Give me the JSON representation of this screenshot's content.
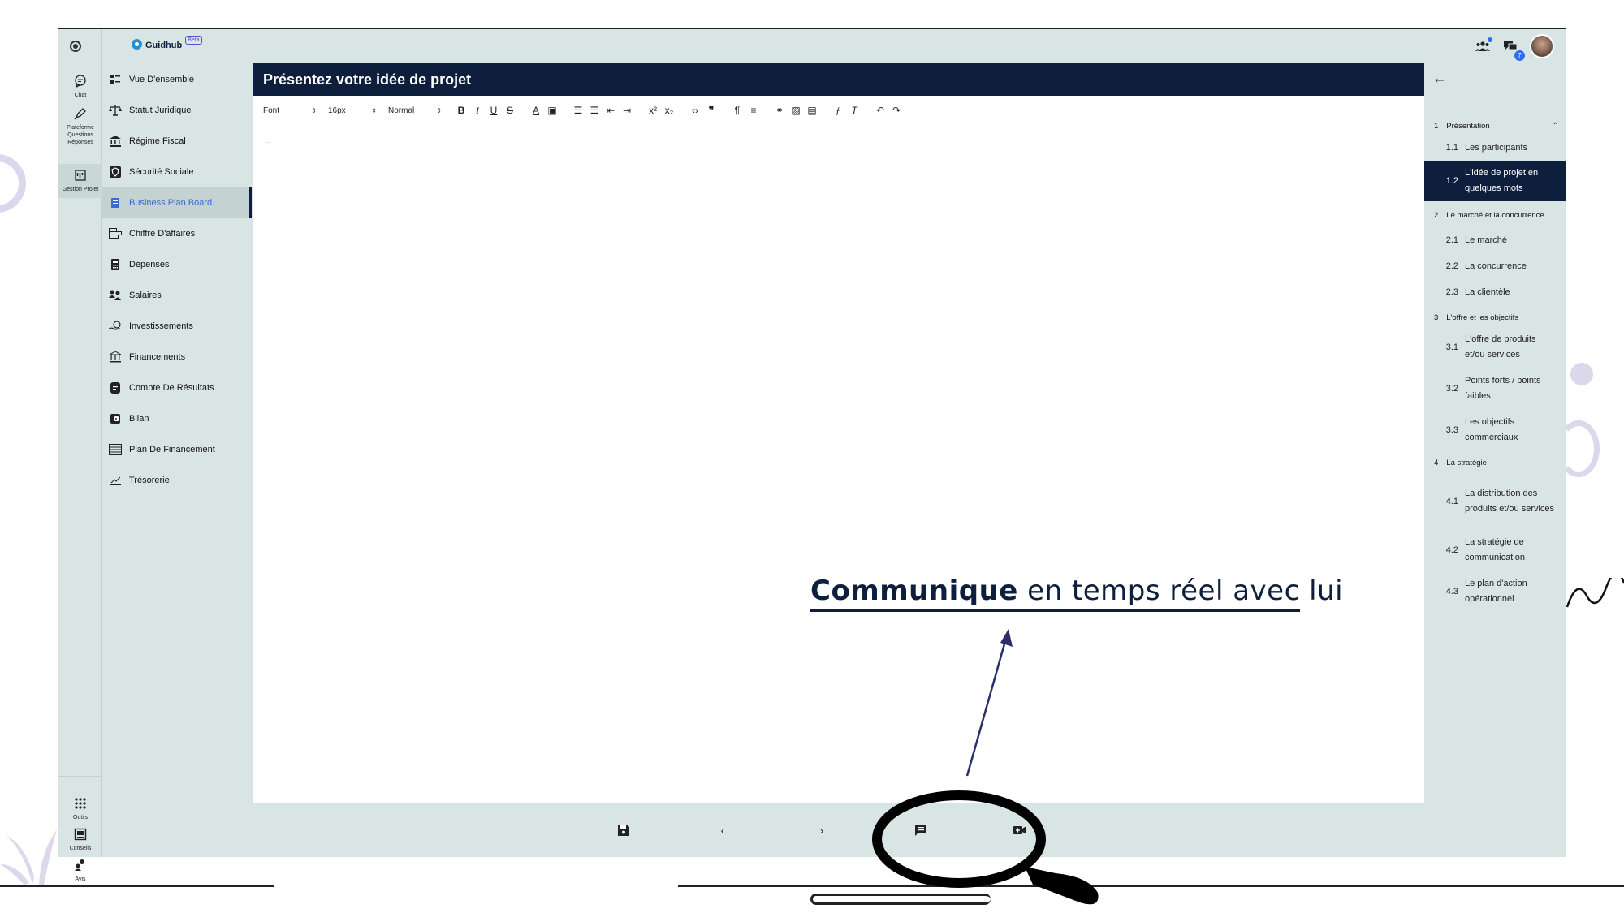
{
  "app": {
    "logo_text": "Guidhub",
    "beta_label": "Beta",
    "message_count": "7"
  },
  "rail": {
    "items": [
      {
        "label": "Chat"
      },
      {
        "label": "Plateforme Questions Réponses"
      },
      {
        "label": "Gestion Projet"
      }
    ],
    "bottom_items": [
      {
        "label": "Outils"
      },
      {
        "label": "Conseils"
      },
      {
        "label": "Avis"
      }
    ]
  },
  "sidebar": {
    "items": [
      {
        "label": "Vue D'ensemble",
        "icon": "dashboard-icon"
      },
      {
        "label": "Statut Juridique",
        "icon": "scale-icon"
      },
      {
        "label": "Régime Fiscal",
        "icon": "bank-icon"
      },
      {
        "label": "Sécurité Sociale",
        "icon": "shield-icon"
      },
      {
        "label": "Business Plan Board",
        "icon": "document-icon",
        "active": true
      },
      {
        "label": "Chiffre D'affaires",
        "icon": "bar-chart-icon"
      },
      {
        "label": "Dépenses",
        "icon": "calculator-icon"
      },
      {
        "label": "Salaires",
        "icon": "people-icon"
      },
      {
        "label": "Investissements",
        "icon": "money-hand-icon"
      },
      {
        "label": "Financements",
        "icon": "bank-icon"
      },
      {
        "label": "Compte De Résultats",
        "icon": "receipt-icon"
      },
      {
        "label": "Bilan",
        "icon": "wallet-icon"
      },
      {
        "label": "Plan De Financement",
        "icon": "table-icon"
      },
      {
        "label": "Trésorerie",
        "icon": "line-chart-icon"
      }
    ]
  },
  "editor": {
    "title": "Présentez votre idée de projet",
    "toolbar": {
      "font_label": "Font",
      "size_label": "16px",
      "style_label": "Normal"
    },
    "placeholder": "..."
  },
  "outline": {
    "sections": [
      {
        "num": "1",
        "label": "Présentation",
        "subs": [
          {
            "num": "1.1",
            "label": "Les participants"
          },
          {
            "num": "1.2",
            "label": "L'idée de projet en quelques mots",
            "active": true
          }
        ]
      },
      {
        "num": "2",
        "label": "Le marché et la concurrence",
        "subs": [
          {
            "num": "2.1",
            "label": "Le marché"
          },
          {
            "num": "2.2",
            "label": "La concurrence"
          },
          {
            "num": "2.3",
            "label": "La clientèle"
          }
        ]
      },
      {
        "num": "3",
        "label": "L'offre et les objectifs",
        "subs": [
          {
            "num": "3.1",
            "label": "L'offre de produits et/ou services"
          },
          {
            "num": "3.2",
            "label": "Points forts / points faibles"
          },
          {
            "num": "3.3",
            "label": "Les objectifs commerciaux"
          }
        ]
      },
      {
        "num": "4",
        "label": "La stratégie",
        "subs": [
          {
            "num": "4.1",
            "label": "La distribution des produits et/ou services"
          },
          {
            "num": "4.2",
            "label": "La stratégie de communication"
          },
          {
            "num": "4.3",
            "label": "Le plan d'action opérationnel"
          }
        ]
      }
    ]
  },
  "annotation": {
    "bold": "Communique",
    "rest": " en temps réel avec lui"
  },
  "colors": {
    "navy": "#0e1f3d",
    "panel": "#d9e5e4",
    "active_link": "#3a6ad6",
    "badge": "#2f6df0"
  }
}
